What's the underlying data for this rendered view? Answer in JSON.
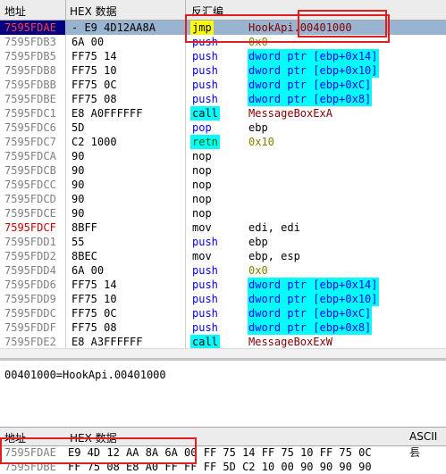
{
  "header": {
    "col_address": "地址",
    "col_hex": "HEX 数据",
    "col_disasm": "反汇编"
  },
  "rows": [
    {
      "addr": "7595FDAE",
      "addr_style": "red",
      "hex": "- E9 4D12AA8A",
      "mnemonic": "jmp",
      "mn_style": "yellow",
      "operand": "HookApi.00401000",
      "op_style": "dred",
      "selected": true
    },
    {
      "addr": "7595FDB3",
      "hex": "6A 00",
      "mnemonic": "push",
      "mn_style": "blue",
      "operand": "0x0",
      "op_style": "olive"
    },
    {
      "addr": "7595FDB5",
      "hex": "FF75 14",
      "mnemonic": "push",
      "mn_style": "blue",
      "operand": "dword ptr [ebp+0x14]",
      "op_style": "blue"
    },
    {
      "addr": "7595FDB8",
      "hex": "FF75 10",
      "mnemonic": "push",
      "mn_style": "blue",
      "operand": "dword ptr [ebp+0x10]",
      "op_style": "blue"
    },
    {
      "addr": "7595FDBB",
      "hex": "FF75 0C",
      "mnemonic": "push",
      "mn_style": "blue",
      "operand": "dword ptr [ebp+0xC]",
      "op_style": "blue"
    },
    {
      "addr": "7595FDBE",
      "hex": "FF75 08",
      "mnemonic": "push",
      "mn_style": "blue",
      "operand": "dword ptr [ebp+0x8]",
      "op_style": "blue"
    },
    {
      "addr": "7595FDC1",
      "hex": "E8 A0FFFFFF",
      "mnemonic": "call",
      "mn_style": "call",
      "operand": "MessageBoxExA",
      "op_style": "dred"
    },
    {
      "addr": "7595FDC6",
      "hex": "5D",
      "mnemonic": "pop",
      "mn_style": "blue",
      "operand": "ebp",
      "op_style": ""
    },
    {
      "addr": "7595FDC7",
      "hex": "C2 1000",
      "mnemonic": "retn",
      "mn_style": "retn",
      "operand": "0x10",
      "op_style": "olive"
    },
    {
      "addr": "7595FDCA",
      "hex": "90",
      "mnemonic": "nop",
      "mn_style": "",
      "operand": "",
      "op_style": ""
    },
    {
      "addr": "7595FDCB",
      "hex": "90",
      "mnemonic": "nop",
      "mn_style": "",
      "operand": "",
      "op_style": ""
    },
    {
      "addr": "7595FDCC",
      "hex": "90",
      "mnemonic": "nop",
      "mn_style": "",
      "operand": "",
      "op_style": ""
    },
    {
      "addr": "7595FDCD",
      "hex": "90",
      "mnemonic": "nop",
      "mn_style": "",
      "operand": "",
      "op_style": ""
    },
    {
      "addr": "7595FDCE",
      "hex": "90",
      "mnemonic": "nop",
      "mn_style": "",
      "operand": "",
      "op_style": ""
    },
    {
      "addr": "7595FDCF",
      "addr_style": "red",
      "hex": "8BFF",
      "mnemonic": "mov",
      "mn_style": "",
      "operand": "edi, edi",
      "op_style": ""
    },
    {
      "addr": "7595FDD1",
      "hex": "55",
      "mnemonic": "push",
      "mn_style": "blue",
      "operand": "ebp",
      "op_style": ""
    },
    {
      "addr": "7595FDD2",
      "hex": "8BEC",
      "mnemonic": "mov",
      "mn_style": "",
      "operand": "ebp, esp",
      "op_style": ""
    },
    {
      "addr": "7595FDD4",
      "hex": "6A 00",
      "mnemonic": "push",
      "mn_style": "blue",
      "operand": "0x0",
      "op_style": "olive"
    },
    {
      "addr": "7595FDD6",
      "hex": "FF75 14",
      "mnemonic": "push",
      "mn_style": "blue",
      "operand": "dword ptr [ebp+0x14]",
      "op_style": "blue"
    },
    {
      "addr": "7595FDD9",
      "hex": "FF75 10",
      "mnemonic": "push",
      "mn_style": "blue",
      "operand": "dword ptr [ebp+0x10]",
      "op_style": "blue"
    },
    {
      "addr": "7595FDDC",
      "hex": "FF75 0C",
      "mnemonic": "push",
      "mn_style": "blue",
      "operand": "dword ptr [ebp+0xC]",
      "op_style": "blue"
    },
    {
      "addr": "7595FDDF",
      "hex": "FF75 08",
      "mnemonic": "push",
      "mn_style": "blue",
      "operand": "dword ptr [ebp+0x8]",
      "op_style": "blue"
    },
    {
      "addr": "7595FDE2",
      "hex": "E8 A3FFFFFF",
      "mnemonic": "call",
      "mn_style": "call",
      "operand": "MessageBoxExW",
      "op_style": "dred"
    }
  ],
  "info": {
    "text": "00401000=HookApi.00401000"
  },
  "dump": {
    "header": {
      "col_address": "地址",
      "col_hex": "HEX 数据",
      "col_ascii": "ASCII"
    },
    "rows": [
      {
        "addr": "7595FDAE",
        "hex": "E9 4D 12 AA 8A 6A 00 FF 75 14 FF 75 10 FF 75 0C",
        "ascii": "镸"
      },
      {
        "addr": "7595FDBE",
        "hex": "FF 75 08 E8 A0 FF FF FF 5D C2 10 00 90 90 90 90",
        "ascii": ""
      }
    ]
  },
  "colors": {
    "selection": "#99b4d1",
    "address_selected_bg": "#000080",
    "highlight_box": "#e02020",
    "cyan": "#00ffff",
    "yellow": "#ffff00"
  }
}
